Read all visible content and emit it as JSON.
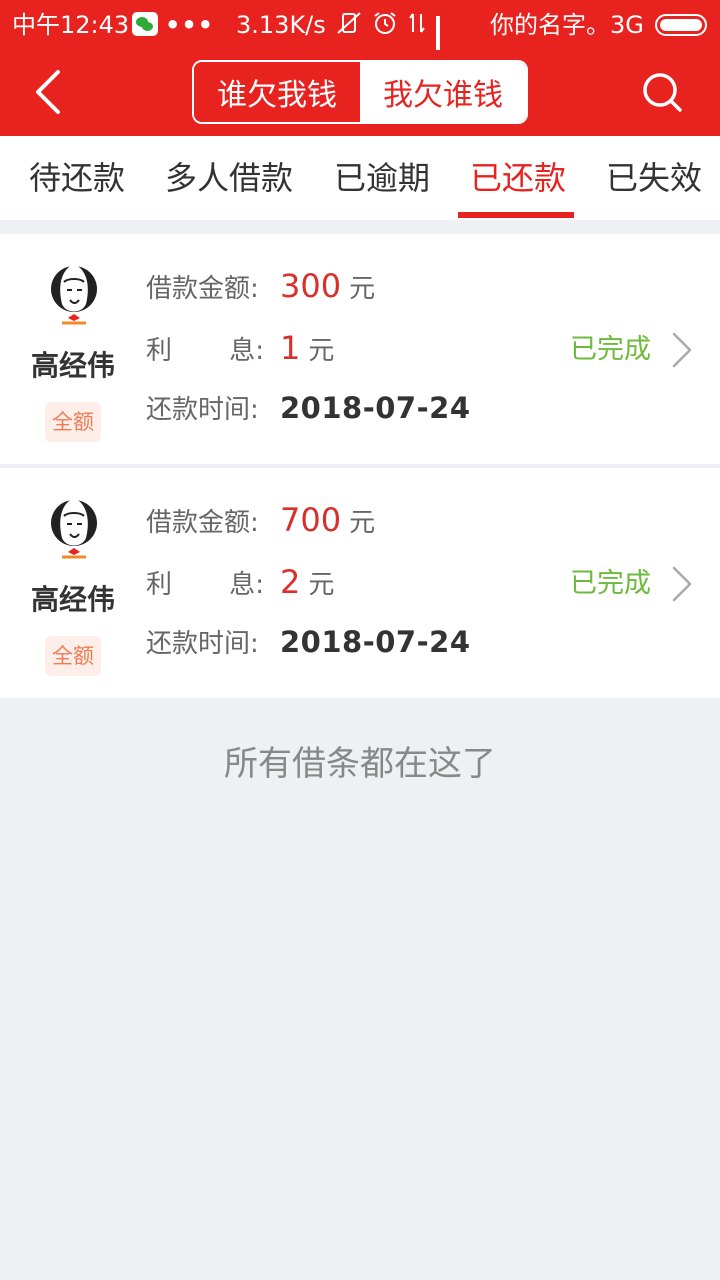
{
  "status_bar": {
    "time": "中午12:43",
    "dots": "•••",
    "speed": "3.13K/s",
    "carrier": "你的名字。3G"
  },
  "header": {
    "segments": [
      {
        "label": "谁欠我钱",
        "active": false
      },
      {
        "label": "我欠谁钱",
        "active": true
      }
    ]
  },
  "tabs": [
    {
      "label": "待还款"
    },
    {
      "label": "多人借款"
    },
    {
      "label": "已逾期"
    },
    {
      "label": "已还款",
      "active": true
    },
    {
      "label": "已失效"
    }
  ],
  "labels": {
    "amount": "借款金额:",
    "interest_a": "利",
    "interest_b": "息:",
    "repay_time": "还款时间:",
    "unit": "元"
  },
  "loans": [
    {
      "name": "高经伟",
      "badge": "全额",
      "amount": "300",
      "interest": "1",
      "repay_date": "2018-07-24",
      "status": "已完成"
    },
    {
      "name": "高经伟",
      "badge": "全额",
      "amount": "700",
      "interest": "2",
      "repay_date": "2018-07-24",
      "status": "已完成"
    }
  ],
  "footer": {
    "note": "所有借条都在这了"
  },
  "colors": {
    "brand_red": "#e8221f",
    "amount_red": "#d9302c",
    "status_green": "#6cbb3c",
    "badge_bg": "#fdeee9",
    "badge_text": "#f07b54",
    "page_bg": "#eff0f4"
  }
}
